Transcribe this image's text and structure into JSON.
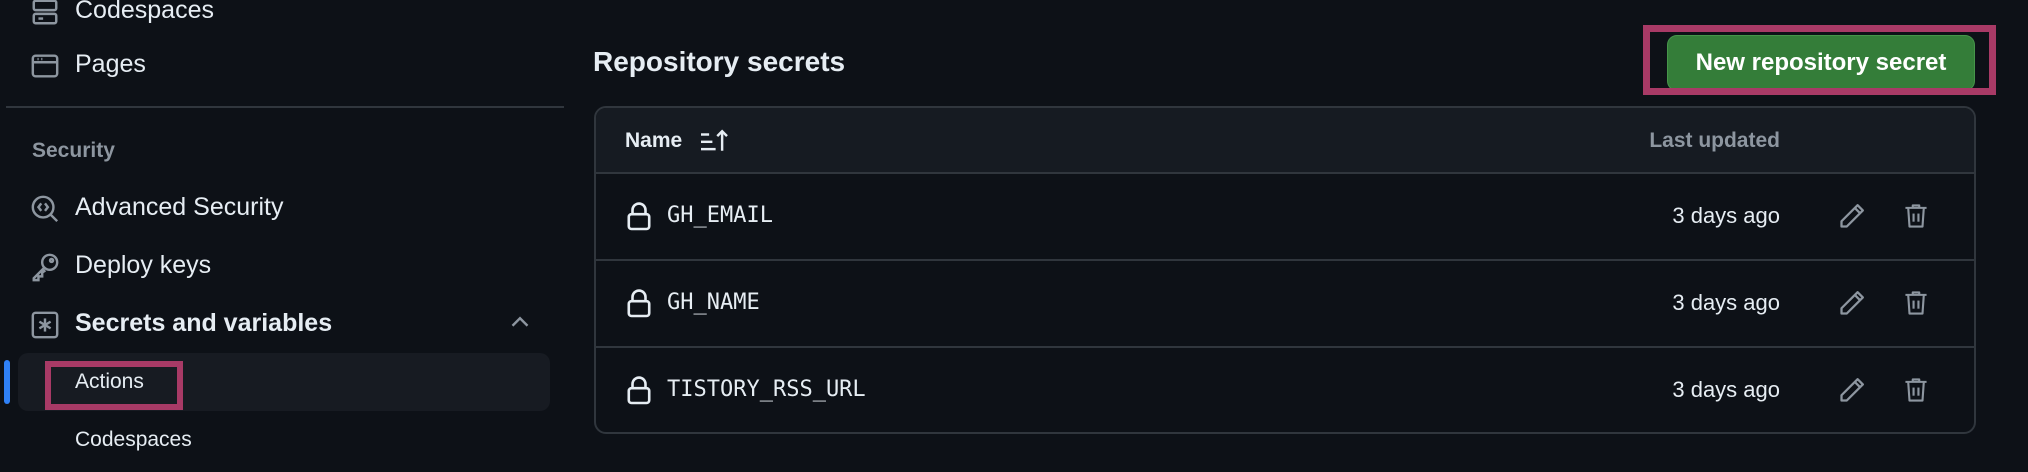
{
  "sidebar": {
    "top_items": [
      {
        "label": "Codespaces",
        "icon": "server-icon"
      },
      {
        "label": "Pages",
        "icon": "browser-icon"
      }
    ],
    "section_heading": "Security",
    "security_items": [
      {
        "label": "Advanced Security",
        "icon": "code-scan-icon"
      },
      {
        "label": "Deploy keys",
        "icon": "key-icon"
      },
      {
        "label": "Secrets and variables",
        "icon": "asterisk-icon",
        "expanded": true
      }
    ],
    "sub_items": [
      {
        "label": "Actions",
        "active": true
      },
      {
        "label": "Codespaces",
        "active": false
      }
    ]
  },
  "main": {
    "title": "Repository secrets",
    "new_button_label": "New repository secret",
    "table": {
      "columns": {
        "name": "Name",
        "updated": "Last updated"
      },
      "rows": [
        {
          "name": "GH_EMAIL",
          "updated": "3 days ago"
        },
        {
          "name": "GH_NAME",
          "updated": "3 days ago"
        },
        {
          "name": "TISTORY_RSS_URL",
          "updated": "3 days ago"
        }
      ]
    }
  },
  "colors": {
    "background": "#0d1117",
    "primary_button": "#347d39",
    "active_marker": "#2f81f7",
    "annotation_highlight": "#a83a66"
  }
}
